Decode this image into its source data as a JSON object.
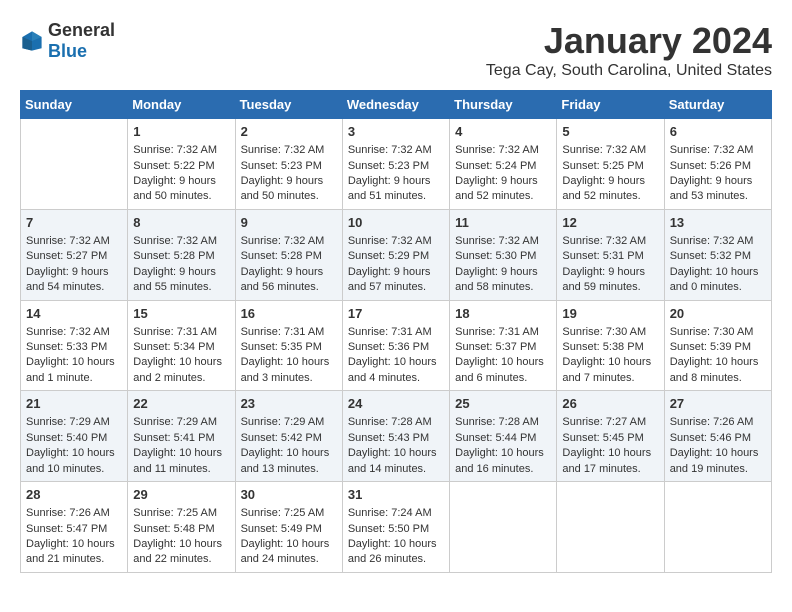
{
  "header": {
    "logo_general": "General",
    "logo_blue": "Blue",
    "title": "January 2024",
    "subtitle": "Tega Cay, South Carolina, United States"
  },
  "days_of_week": [
    "Sunday",
    "Monday",
    "Tuesday",
    "Wednesday",
    "Thursday",
    "Friday",
    "Saturday"
  ],
  "weeks": [
    [
      {
        "day": "",
        "empty": true
      },
      {
        "day": "1",
        "sunrise": "Sunrise: 7:32 AM",
        "sunset": "Sunset: 5:22 PM",
        "daylight": "Daylight: 9 hours and 50 minutes."
      },
      {
        "day": "2",
        "sunrise": "Sunrise: 7:32 AM",
        "sunset": "Sunset: 5:23 PM",
        "daylight": "Daylight: 9 hours and 50 minutes."
      },
      {
        "day": "3",
        "sunrise": "Sunrise: 7:32 AM",
        "sunset": "Sunset: 5:23 PM",
        "daylight": "Daylight: 9 hours and 51 minutes."
      },
      {
        "day": "4",
        "sunrise": "Sunrise: 7:32 AM",
        "sunset": "Sunset: 5:24 PM",
        "daylight": "Daylight: 9 hours and 52 minutes."
      },
      {
        "day": "5",
        "sunrise": "Sunrise: 7:32 AM",
        "sunset": "Sunset: 5:25 PM",
        "daylight": "Daylight: 9 hours and 52 minutes."
      },
      {
        "day": "6",
        "sunrise": "Sunrise: 7:32 AM",
        "sunset": "Sunset: 5:26 PM",
        "daylight": "Daylight: 9 hours and 53 minutes."
      }
    ],
    [
      {
        "day": "7",
        "sunrise": "Sunrise: 7:32 AM",
        "sunset": "Sunset: 5:27 PM",
        "daylight": "Daylight: 9 hours and 54 minutes."
      },
      {
        "day": "8",
        "sunrise": "Sunrise: 7:32 AM",
        "sunset": "Sunset: 5:28 PM",
        "daylight": "Daylight: 9 hours and 55 minutes."
      },
      {
        "day": "9",
        "sunrise": "Sunrise: 7:32 AM",
        "sunset": "Sunset: 5:28 PM",
        "daylight": "Daylight: 9 hours and 56 minutes."
      },
      {
        "day": "10",
        "sunrise": "Sunrise: 7:32 AM",
        "sunset": "Sunset: 5:29 PM",
        "daylight": "Daylight: 9 hours and 57 minutes."
      },
      {
        "day": "11",
        "sunrise": "Sunrise: 7:32 AM",
        "sunset": "Sunset: 5:30 PM",
        "daylight": "Daylight: 9 hours and 58 minutes."
      },
      {
        "day": "12",
        "sunrise": "Sunrise: 7:32 AM",
        "sunset": "Sunset: 5:31 PM",
        "daylight": "Daylight: 9 hours and 59 minutes."
      },
      {
        "day": "13",
        "sunrise": "Sunrise: 7:32 AM",
        "sunset": "Sunset: 5:32 PM",
        "daylight": "Daylight: 10 hours and 0 minutes."
      }
    ],
    [
      {
        "day": "14",
        "sunrise": "Sunrise: 7:32 AM",
        "sunset": "Sunset: 5:33 PM",
        "daylight": "Daylight: 10 hours and 1 minute."
      },
      {
        "day": "15",
        "sunrise": "Sunrise: 7:31 AM",
        "sunset": "Sunset: 5:34 PM",
        "daylight": "Daylight: 10 hours and 2 minutes."
      },
      {
        "day": "16",
        "sunrise": "Sunrise: 7:31 AM",
        "sunset": "Sunset: 5:35 PM",
        "daylight": "Daylight: 10 hours and 3 minutes."
      },
      {
        "day": "17",
        "sunrise": "Sunrise: 7:31 AM",
        "sunset": "Sunset: 5:36 PM",
        "daylight": "Daylight: 10 hours and 4 minutes."
      },
      {
        "day": "18",
        "sunrise": "Sunrise: 7:31 AM",
        "sunset": "Sunset: 5:37 PM",
        "daylight": "Daylight: 10 hours and 6 minutes."
      },
      {
        "day": "19",
        "sunrise": "Sunrise: 7:30 AM",
        "sunset": "Sunset: 5:38 PM",
        "daylight": "Daylight: 10 hours and 7 minutes."
      },
      {
        "day": "20",
        "sunrise": "Sunrise: 7:30 AM",
        "sunset": "Sunset: 5:39 PM",
        "daylight": "Daylight: 10 hours and 8 minutes."
      }
    ],
    [
      {
        "day": "21",
        "sunrise": "Sunrise: 7:29 AM",
        "sunset": "Sunset: 5:40 PM",
        "daylight": "Daylight: 10 hours and 10 minutes."
      },
      {
        "day": "22",
        "sunrise": "Sunrise: 7:29 AM",
        "sunset": "Sunset: 5:41 PM",
        "daylight": "Daylight: 10 hours and 11 minutes."
      },
      {
        "day": "23",
        "sunrise": "Sunrise: 7:29 AM",
        "sunset": "Sunset: 5:42 PM",
        "daylight": "Daylight: 10 hours and 13 minutes."
      },
      {
        "day": "24",
        "sunrise": "Sunrise: 7:28 AM",
        "sunset": "Sunset: 5:43 PM",
        "daylight": "Daylight: 10 hours and 14 minutes."
      },
      {
        "day": "25",
        "sunrise": "Sunrise: 7:28 AM",
        "sunset": "Sunset: 5:44 PM",
        "daylight": "Daylight: 10 hours and 16 minutes."
      },
      {
        "day": "26",
        "sunrise": "Sunrise: 7:27 AM",
        "sunset": "Sunset: 5:45 PM",
        "daylight": "Daylight: 10 hours and 17 minutes."
      },
      {
        "day": "27",
        "sunrise": "Sunrise: 7:26 AM",
        "sunset": "Sunset: 5:46 PM",
        "daylight": "Daylight: 10 hours and 19 minutes."
      }
    ],
    [
      {
        "day": "28",
        "sunrise": "Sunrise: 7:26 AM",
        "sunset": "Sunset: 5:47 PM",
        "daylight": "Daylight: 10 hours and 21 minutes."
      },
      {
        "day": "29",
        "sunrise": "Sunrise: 7:25 AM",
        "sunset": "Sunset: 5:48 PM",
        "daylight": "Daylight: 10 hours and 22 minutes."
      },
      {
        "day": "30",
        "sunrise": "Sunrise: 7:25 AM",
        "sunset": "Sunset: 5:49 PM",
        "daylight": "Daylight: 10 hours and 24 minutes."
      },
      {
        "day": "31",
        "sunrise": "Sunrise: 7:24 AM",
        "sunset": "Sunset: 5:50 PM",
        "daylight": "Daylight: 10 hours and 26 minutes."
      },
      {
        "day": "",
        "empty": true
      },
      {
        "day": "",
        "empty": true
      },
      {
        "day": "",
        "empty": true
      }
    ]
  ]
}
